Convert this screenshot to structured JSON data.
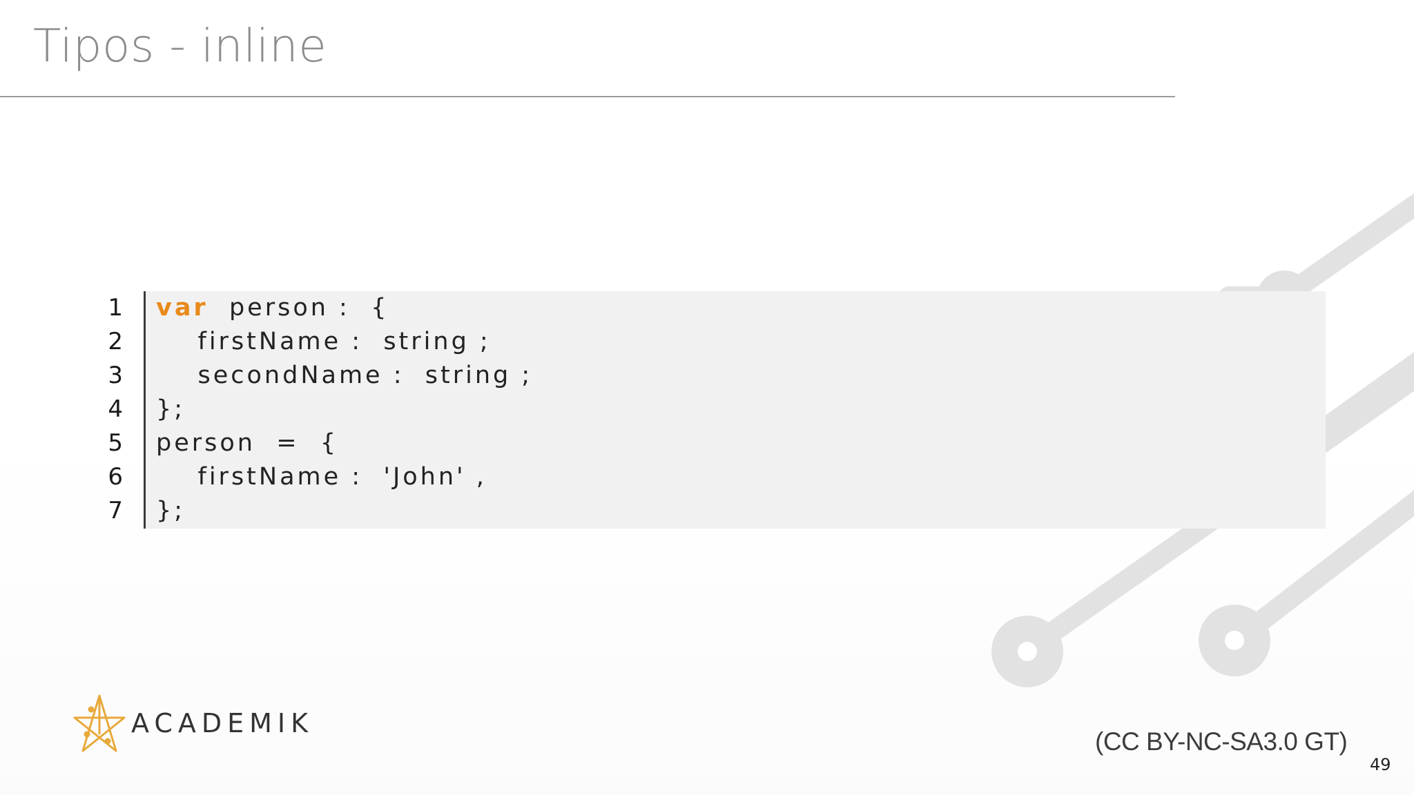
{
  "slide": {
    "title": "Tipos - inline",
    "page_number": "49",
    "license": "(CC BY-NC-SA3.0 GT)",
    "brand": "ACADEMIK"
  },
  "code": {
    "lines": [
      {
        "number": "1",
        "keyword": "var",
        "rest": "  person :  {"
      },
      {
        "number": "2",
        "keyword": "",
        "rest": "    firstName :  string ;"
      },
      {
        "number": "3",
        "keyword": "",
        "rest": "    secondName :  string ;"
      },
      {
        "number": "4",
        "keyword": "",
        "rest": "};"
      },
      {
        "number": "5",
        "keyword": "",
        "rest": "person  =  {"
      },
      {
        "number": "6",
        "keyword": "",
        "rest": "    firstName :  'John' ,"
      },
      {
        "number": "7",
        "keyword": "",
        "rest": "};"
      }
    ]
  },
  "colors": {
    "title": "#8c8c8c",
    "keyword": "#e88a1a",
    "code_background": "#f2f1f1",
    "circuit": "#e2e2e2"
  },
  "icons": {
    "logo": "academik-star-logo-icon",
    "background": "circuit-trace-decoration"
  }
}
